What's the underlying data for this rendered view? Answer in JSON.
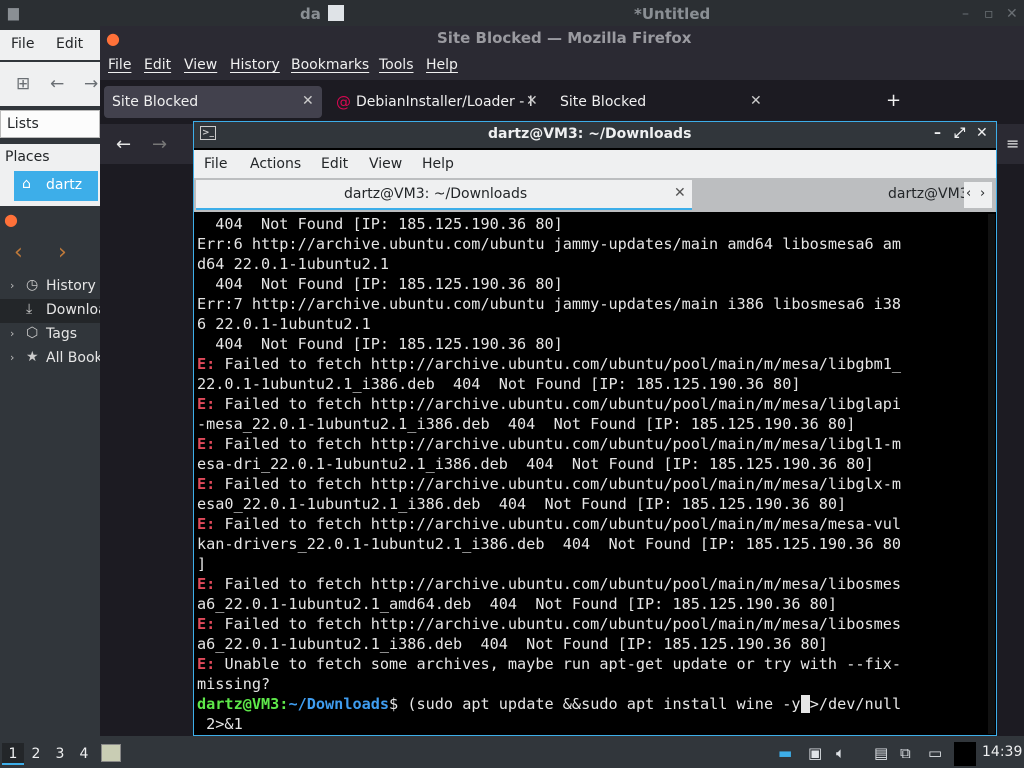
{
  "background_window": {
    "title_left": "da",
    "title_right": "*Untitled"
  },
  "file_manager": {
    "menu": [
      "File",
      "Edit"
    ],
    "lists_label": "Lists",
    "places_label": "Places",
    "places_item": "dartz"
  },
  "library": {
    "tree": [
      "History",
      "Downloa",
      "Tags",
      "All Book"
    ]
  },
  "firefox": {
    "title": "Site Blocked — Mozilla Firefox",
    "menu": [
      "File",
      "Edit",
      "View",
      "History",
      "Bookmarks",
      "Tools",
      "Help"
    ],
    "tabs": [
      "Site Blocked",
      "DebianInstaller/Loader - I",
      "Site Blocked"
    ]
  },
  "terminal": {
    "title": "dartz@VM3: ~/Downloads",
    "menu": [
      "File",
      "Actions",
      "Edit",
      "View",
      "Help"
    ],
    "tabs": [
      "dartz@VM3: ~/Downloads",
      "dartz@VM3"
    ],
    "lines": [
      "  404  Not Found [IP: 185.125.190.36 80]",
      "Err:6 http://archive.ubuntu.com/ubuntu jammy-updates/main amd64 libosmesa6 am",
      "d64 22.0.1-1ubuntu2.1",
      "  404  Not Found [IP: 185.125.190.36 80]",
      "Err:7 http://archive.ubuntu.com/ubuntu jammy-updates/main i386 libosmesa6 i38",
      "6 22.0.1-1ubuntu2.1",
      "  404  Not Found [IP: 185.125.190.36 80]",
      "E: Failed to fetch http://archive.ubuntu.com/ubuntu/pool/main/m/mesa/libgbm1_",
      "22.0.1-1ubuntu2.1_i386.deb  404  Not Found [IP: 185.125.190.36 80]",
      "E: Failed to fetch http://archive.ubuntu.com/ubuntu/pool/main/m/mesa/libglapi",
      "-mesa_22.0.1-1ubuntu2.1_i386.deb  404  Not Found [IP: 185.125.190.36 80]",
      "E: Failed to fetch http://archive.ubuntu.com/ubuntu/pool/main/m/mesa/libgl1-m",
      "esa-dri_22.0.1-1ubuntu2.1_i386.deb  404  Not Found [IP: 185.125.190.36 80]",
      "E: Failed to fetch http://archive.ubuntu.com/ubuntu/pool/main/m/mesa/libglx-m",
      "esa0_22.0.1-1ubuntu2.1_i386.deb  404  Not Found [IP: 185.125.190.36 80]",
      "E: Failed to fetch http://archive.ubuntu.com/ubuntu/pool/main/m/mesa/mesa-vul",
      "kan-drivers_22.0.1-1ubuntu2.1_i386.deb  404  Not Found [IP: 185.125.190.36 80",
      "]",
      "E: Failed to fetch http://archive.ubuntu.com/ubuntu/pool/main/m/mesa/libosmes",
      "a6_22.0.1-1ubuntu2.1_amd64.deb  404  Not Found [IP: 185.125.190.36 80]",
      "E: Failed to fetch http://archive.ubuntu.com/ubuntu/pool/main/m/mesa/libosmes",
      "a6_22.0.1-1ubuntu2.1_i386.deb  404  Not Found [IP: 185.125.190.36 80]",
      "E: Unable to fetch some archives, maybe run apt-get update or try with --fix-",
      "missing?"
    ],
    "prompt_user": "dartz@VM3",
    "prompt_path": "~/Downloads",
    "prompt_symbol": "$",
    "command_before_cursor": " (sudo apt update &&sudo apt install wine -y",
    "command_cursor_char": " ",
    "command_after_cursor": ">/dev/null",
    "command_wrap": " 2>&1"
  },
  "panel": {
    "workspaces": [
      "1",
      "2",
      "3",
      "4"
    ],
    "clock": "14:39"
  },
  "colors": {
    "error_red": "#e0495a",
    "prompt_green": "#5ee84a",
    "prompt_blue": "#3f9df0",
    "accent_blue": "#3daee9"
  }
}
